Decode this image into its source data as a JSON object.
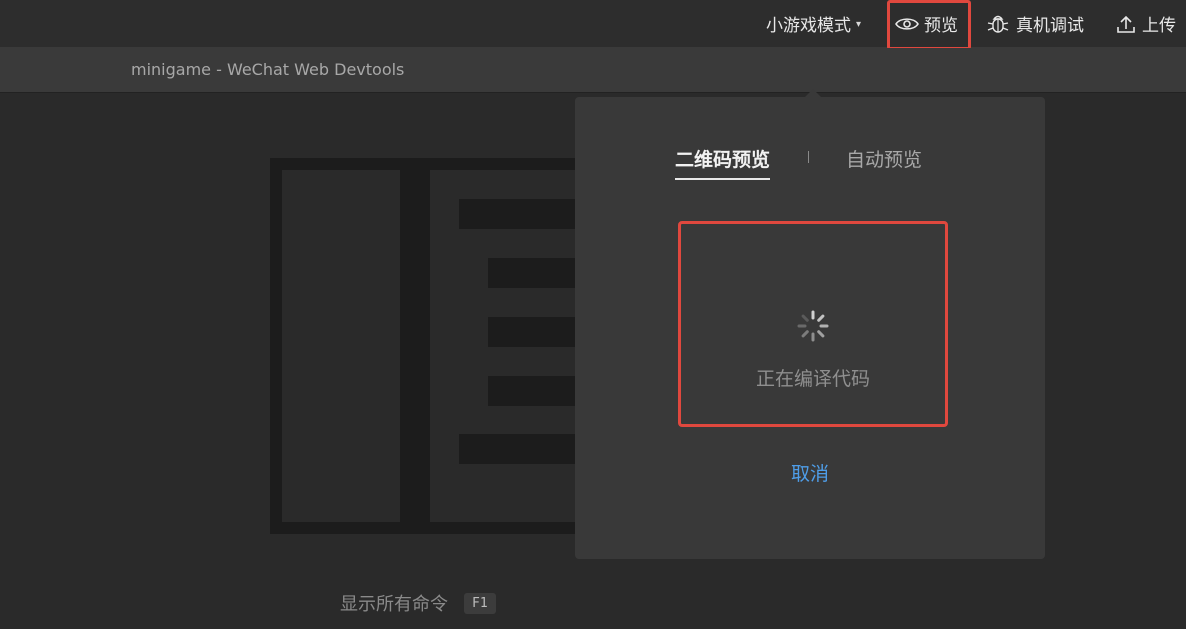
{
  "toolbar": {
    "mode_label": "小游戏模式",
    "mode_caret": "▾",
    "preview_label": "预览",
    "remote_debug_label": "真机调试",
    "upload_label": "上传"
  },
  "window": {
    "title": "minigame - WeChat Web Devtools"
  },
  "main": {
    "command_hint": "显示所有命令",
    "command_shortcut": "F1"
  },
  "preview_popover": {
    "tabs": [
      {
        "label": "二维码预览",
        "active": true
      },
      {
        "label": "自动预览",
        "active": false
      }
    ],
    "status_text": "正在编译代码",
    "cancel_label": "取消"
  },
  "colors": {
    "highlight": "#e0483e",
    "link": "#4e9de8",
    "background": "#2b2b2b",
    "popover": "#393939"
  },
  "icons": [
    "eye-icon",
    "bug-icon",
    "upload-icon",
    "spinner-icon",
    "caret-down-icon"
  ]
}
